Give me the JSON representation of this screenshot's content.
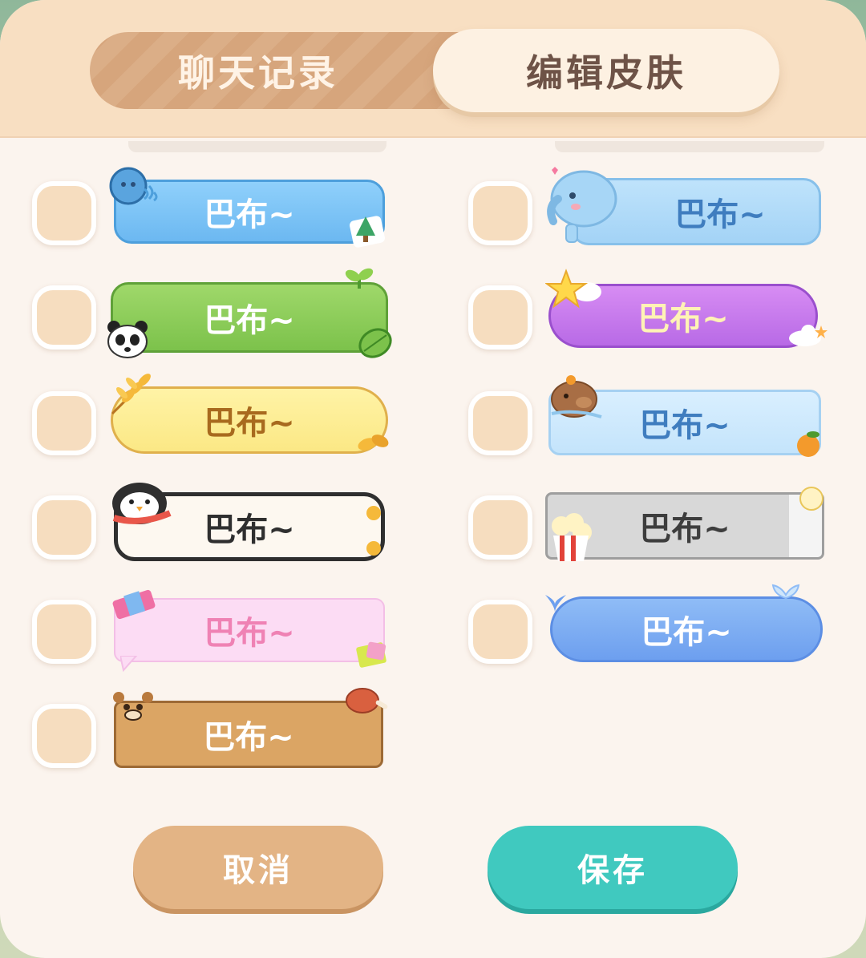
{
  "tabs": {
    "chat_history": "聊天记录",
    "edit_skin": "编辑皮肤",
    "active": "edit_skin"
  },
  "bubble_text": "巴布~",
  "skins": [
    {
      "name": "ocean",
      "text": "巴布~",
      "selected": false
    },
    {
      "name": "elephant",
      "text": "巴布~",
      "selected": false
    },
    {
      "name": "panda-bamboo",
      "text": "巴布~",
      "selected": false
    },
    {
      "name": "star-cloud",
      "text": "巴布~",
      "selected": false
    },
    {
      "name": "autumn-leaf",
      "text": "巴布~",
      "selected": false
    },
    {
      "name": "capybara",
      "text": "巴布~",
      "selected": false
    },
    {
      "name": "penguin",
      "text": "巴布~",
      "selected": false
    },
    {
      "name": "popcorn-ticket",
      "text": "巴布~",
      "selected": false
    },
    {
      "name": "pink-candy",
      "text": "巴布~",
      "selected": false
    },
    {
      "name": "whale",
      "text": "巴布~",
      "selected": false
    },
    {
      "name": "bear-steak",
      "text": "巴布~",
      "selected": false
    }
  ],
  "buttons": {
    "cancel": "取消",
    "save": "保存"
  },
  "colors": {
    "header_bg": "#f8dfc2",
    "panel_bg": "#fbf4ee",
    "checkbox_fill": "#f6ddbf",
    "cancel_button": "#e3b485",
    "save_button": "#40c9bf"
  }
}
